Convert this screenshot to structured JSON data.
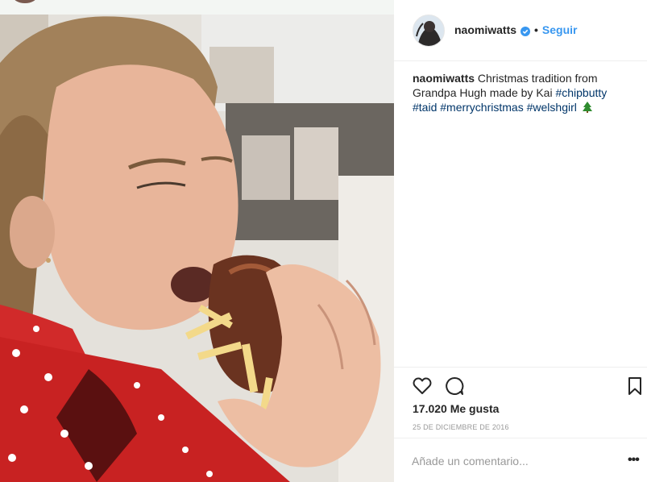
{
  "post": {
    "username": "naomiwatts",
    "separator": "•",
    "follow_label": "Seguir",
    "caption": {
      "username": "naomiwatts",
      "text": " Christmas tradition from Grandpa Hugh made by Kai ",
      "hashtags": [
        "#chipbutty",
        "#taid",
        "#merrychristmas",
        "#welshgirl"
      ]
    },
    "likes": "17.020 Me gusta",
    "date": "25 DE DICIEMBRE DE 2016",
    "comment_placeholder": "Añade un comentario...",
    "more_label": "•••"
  },
  "icons": {
    "verified": "verified-badge-icon",
    "tree": "christmas-tree-emoji",
    "like": "heart-outline-icon",
    "comment": "speech-bubble-icon",
    "save": "bookmark-icon",
    "more": "ellipsis-icon"
  },
  "colors": {
    "link_blue": "#3897f0",
    "hashtag": "#003569",
    "verified": "#3897f0",
    "text": "#262626",
    "muted": "#999999",
    "divider": "#efefef"
  }
}
